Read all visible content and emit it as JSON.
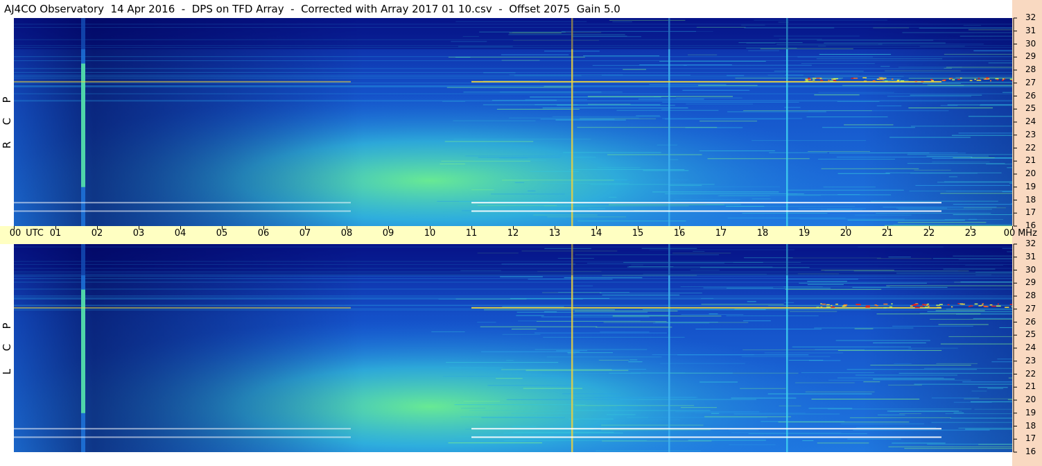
{
  "title": "AJ4CO Observatory  14 Apr 2016  -  DPS on TFD Array  -  Corrected with Array 2017 01 10.csv  -  Offset 2075  Gain 5.0",
  "panels": [
    {
      "polarization": "RCP",
      "letters": [
        "R",
        "C",
        "P"
      ]
    },
    {
      "polarization": "LCP",
      "letters": [
        "L",
        "C",
        "P"
      ]
    }
  ],
  "chart_data": {
    "type": "heatmap",
    "title": "AJ4CO Observatory  14 Apr 2016  -  DPS on TFD Array  -  Corrected with Array 2017 01 10.csv  -  Offset 2075  Gain 5.0",
    "x_axis": {
      "unit_label": "UTC",
      "ticks": [
        "00",
        "01",
        "02",
        "03",
        "04",
        "05",
        "06",
        "07",
        "08",
        "09",
        "10",
        "11",
        "12",
        "13",
        "14",
        "15",
        "16",
        "17",
        "18",
        "19",
        "20",
        "21",
        "22",
        "23",
        "00"
      ],
      "range_hours": [
        0,
        24
      ]
    },
    "y_axis": {
      "unit_label": "MHz",
      "ticks": [
        "32",
        "31",
        "30",
        "29",
        "28",
        "27",
        "26",
        "25",
        "24",
        "23",
        "22",
        "21",
        "20",
        "19",
        "18",
        "17",
        "16"
      ],
      "range_mhz": [
        16,
        32
      ]
    },
    "colormap": [
      "#00006a",
      "#0a1f9a",
      "#1544c9",
      "#1f78e0",
      "#2aa3e6",
      "#35c6dc",
      "#46e0b8",
      "#7cf08a",
      "#c7f25a",
      "#f3d93a",
      "#f07a2a",
      "#e22020",
      "#ffffff"
    ],
    "features": [
      {
        "kind": "vertical_stripe",
        "time_utc": "01:40",
        "color": "#5cf0a0"
      },
      {
        "kind": "vertical_line",
        "time_utc": "13:25",
        "color": "#e8d040"
      },
      {
        "kind": "vertical_line",
        "time_utc": "18:35",
        "color": "#3fd2f0"
      },
      {
        "kind": "vertical_line",
        "time_utc": "15:45",
        "color": "#3fb4f0"
      },
      {
        "kind": "horizontal_line",
        "freq_mhz": 17.8,
        "color": "#ffffff"
      },
      {
        "kind": "horizontal_line",
        "freq_mhz": 17.15,
        "color": "#ffffff"
      },
      {
        "kind": "horizontal_line",
        "freq_mhz": 27.1,
        "color": "#f3d93a"
      },
      {
        "kind": "day_glow",
        "center_time_utc": "10:00",
        "center_freq_mhz": 19.5,
        "color": "#6cf090"
      }
    ]
  }
}
